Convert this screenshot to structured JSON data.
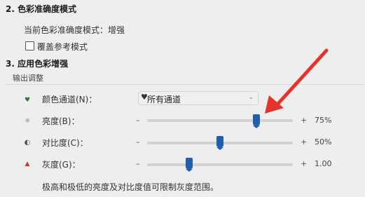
{
  "section2": {
    "heading": "2. 色彩准确度模式",
    "current_mode": "当前色彩准确度模式：增强",
    "reference_checkbox": {
      "label": "覆盖参考模式",
      "checked": false
    }
  },
  "section3": {
    "heading": "3. 应用色彩增强",
    "group_label": "输出调整",
    "channel": {
      "label": "颜色通道(N)：",
      "value": "所有通道"
    },
    "rows": [
      {
        "label": "亮度(B)：",
        "minus": "–",
        "plus": "+",
        "value": "75%",
        "level": 0.75
      },
      {
        "label": "对比度(C)：",
        "minus": "–",
        "plus": "+",
        "value": "50%",
        "level": 0.5
      },
      {
        "label": "灰度(G)：",
        "minus": "–",
        "plus": "+",
        "value": "1.00",
        "level": 0.29
      }
    ],
    "note": "极高和极低的亮度及对比度值可限制灰度范围。"
  },
  "annotation": {
    "arrow_color": "#e5332a"
  },
  "icons": {
    "channel": "color-channel-icon",
    "brightness": "brightness-icon",
    "contrast": "contrast-icon",
    "gamma": "gamma-icon",
    "select_chevron": "chevron-down-icon"
  }
}
